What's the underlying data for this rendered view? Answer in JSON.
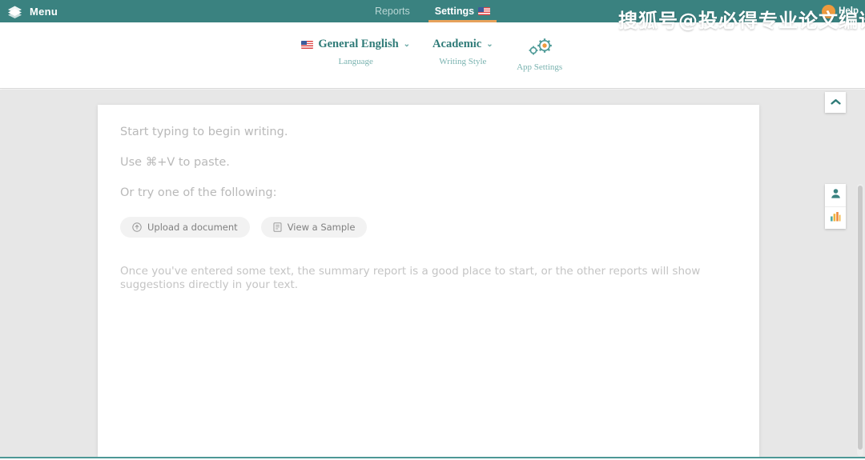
{
  "topbar": {
    "logo_icon": "stacked-layers-logo-icon",
    "menu_label": "Menu",
    "tabs": [
      {
        "label": "Reports",
        "active": false,
        "icon": null
      },
      {
        "label": "Settings",
        "active": true,
        "icon": "us-flag-icon"
      }
    ],
    "help_label": "Help",
    "help_icon": "help-circle-icon",
    "background_color": "#3a8280",
    "active_underline_color": "#e8a35c"
  },
  "watermark": {
    "text": "搜狐号@投必得专业论文编译"
  },
  "subnav": {
    "items": [
      {
        "title": "General English",
        "subtitle": "Language",
        "icon": "us-flag-icon",
        "chevron": "⌄"
      },
      {
        "title": "Academic",
        "subtitle": "Writing Style",
        "icon": null,
        "chevron": "⌄"
      },
      {
        "title": "",
        "subtitle": "App Settings",
        "icon": "gears-icon",
        "chevron": ""
      }
    ],
    "accent_color": "#2f7b78"
  },
  "editor": {
    "hints": [
      "Start typing to begin writing.",
      "Use ⌘+V to paste.",
      "Or try one of the following:"
    ],
    "buttons": [
      {
        "label": "Upload a document",
        "icon": "upload-circle-icon"
      },
      {
        "label": "View a Sample",
        "icon": "document-icon"
      }
    ],
    "summary_text": "Once you've entered some text, the summary report is a good place to start, or the other reports will show suggestions directly in your text."
  },
  "rail": {
    "collapse_icon": "chevron-up-icon",
    "buttons": [
      {
        "icon": "person-icon",
        "name": "profile"
      },
      {
        "icon": "bar-chart-icon",
        "name": "statistics"
      }
    ]
  }
}
